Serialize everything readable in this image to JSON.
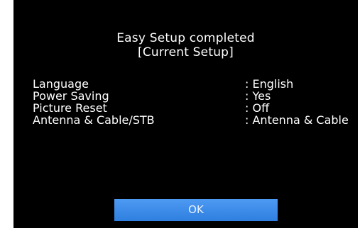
{
  "dialog": {
    "title": "Easy Setup completed",
    "subtitle": "[Current Setup]"
  },
  "settings": [
    {
      "label": "Language",
      "value": ": English"
    },
    {
      "label": "Power Saving",
      "value": ": Yes"
    },
    {
      "label": "Picture Reset",
      "value": ": Off"
    },
    {
      "label": "Antenna & Cable/STB",
      "value": ": Antenna & Cable"
    }
  ],
  "actions": {
    "ok_label": "OK"
  },
  "colors": {
    "background": "#000000",
    "text": "#ffffff",
    "accent": "#3d8cee"
  }
}
